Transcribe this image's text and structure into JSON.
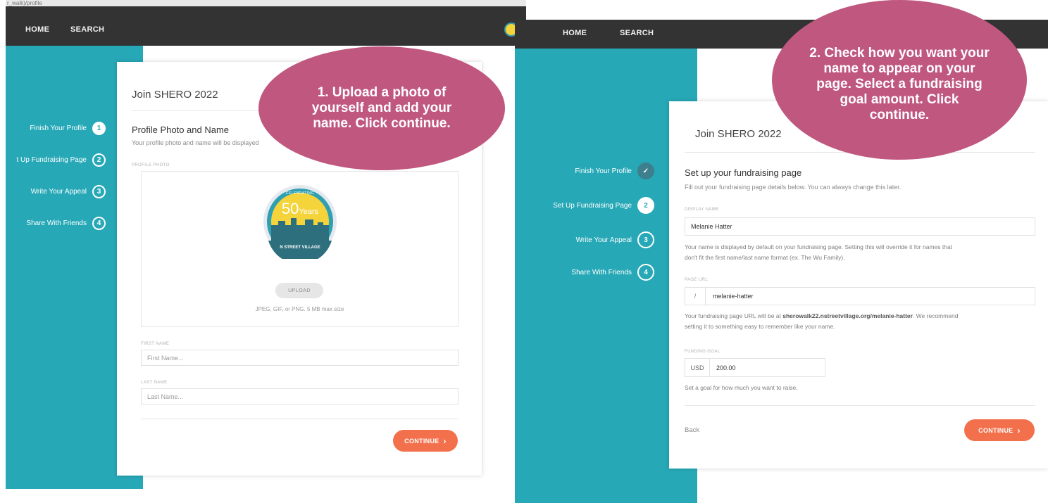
{
  "left_screen": {
    "address_text": "r_walk)/profile",
    "nav": {
      "home": "HOME",
      "search": "SEARCH"
    },
    "card_title": "Join SHERO 2022",
    "steps": [
      {
        "label": "Finish Your Profile",
        "number": "1",
        "state": "active"
      },
      {
        "label": "t Up Fundraising Page",
        "number": "2",
        "state": "todo"
      },
      {
        "label": "Write Your Appeal",
        "number": "3",
        "state": "todo"
      },
      {
        "label": "Share With Friends",
        "number": "4",
        "state": "todo"
      }
    ],
    "section_title": "Profile Photo and Name",
    "section_sub": "Your profile photo and name will be displayed",
    "profile_photo_label": "PROFILE PHOTO",
    "logo_top_text": "CELEBRATING",
    "logo_years_number": "50",
    "logo_years_word": "Years",
    "logo_bottom_text": "N STREET VILLAGE",
    "upload_label": "UPLOAD",
    "upload_hint": "JPEG, GIF, or PNG. 5 MB max size",
    "first_name_label": "FIRST NAME",
    "first_name_placeholder": "First Name...",
    "last_name_label": "LAST NAME",
    "last_name_placeholder": "Last Name...",
    "continue_label": "CONTINUE",
    "callout": "1. Upload a photo of yourself and add your name. Click continue."
  },
  "right_screen": {
    "nav": {
      "home": "HOME",
      "search": "SEARCH"
    },
    "card_title": "Join SHERO 2022",
    "steps": [
      {
        "label": "Finish Your Profile",
        "number": "✓",
        "state": "done"
      },
      {
        "label": "Set Up Fundraising Page",
        "number": "2",
        "state": "active"
      },
      {
        "label": "Write Your Appeal",
        "number": "3",
        "state": "todo"
      },
      {
        "label": "Share With Friends",
        "number": "4",
        "state": "todo"
      }
    ],
    "section_title": "Set up your fundraising page",
    "section_sub": "Fill out your fundraising page details below. You can always change this later.",
    "display_name_label": "DISPLAY NAME",
    "display_name_value": "Melanie Hatter",
    "display_name_help_1": "Your name is displayed by default on your fundraising page. Setting this will override it for names that",
    "display_name_help_2": "don't fit the first name/last name format (ex. The Wu Family).",
    "page_url_label": "PAGE URL",
    "page_url_prefix": "/",
    "page_url_value": "melanie-hatter",
    "page_url_help_prefix": "Your fundraising page URL will be at ",
    "page_url_help_link": "sherowalk22.nstreetvillage.org/melanie-hatter",
    "page_url_help_suffix": ". We recommend",
    "page_url_help_2": "setting it to something easy to remember like your name.",
    "funding_goal_label": "FUNDING GOAL",
    "currency": "USD",
    "funding_goal_value": "200.00",
    "funding_goal_help": "Set a goal for how much you want to raise.",
    "back_label": "Back",
    "continue_label": "CONTINUE",
    "callout": "2. Check how you want your name to appear on your page. Select a fundraising goal amount. Click continue."
  },
  "colors": {
    "teal": "#27a8b7",
    "nav": "#333333",
    "accent_orange": "#f2714c",
    "callout": "#c0577f",
    "done_check": "#3d7f8c"
  }
}
